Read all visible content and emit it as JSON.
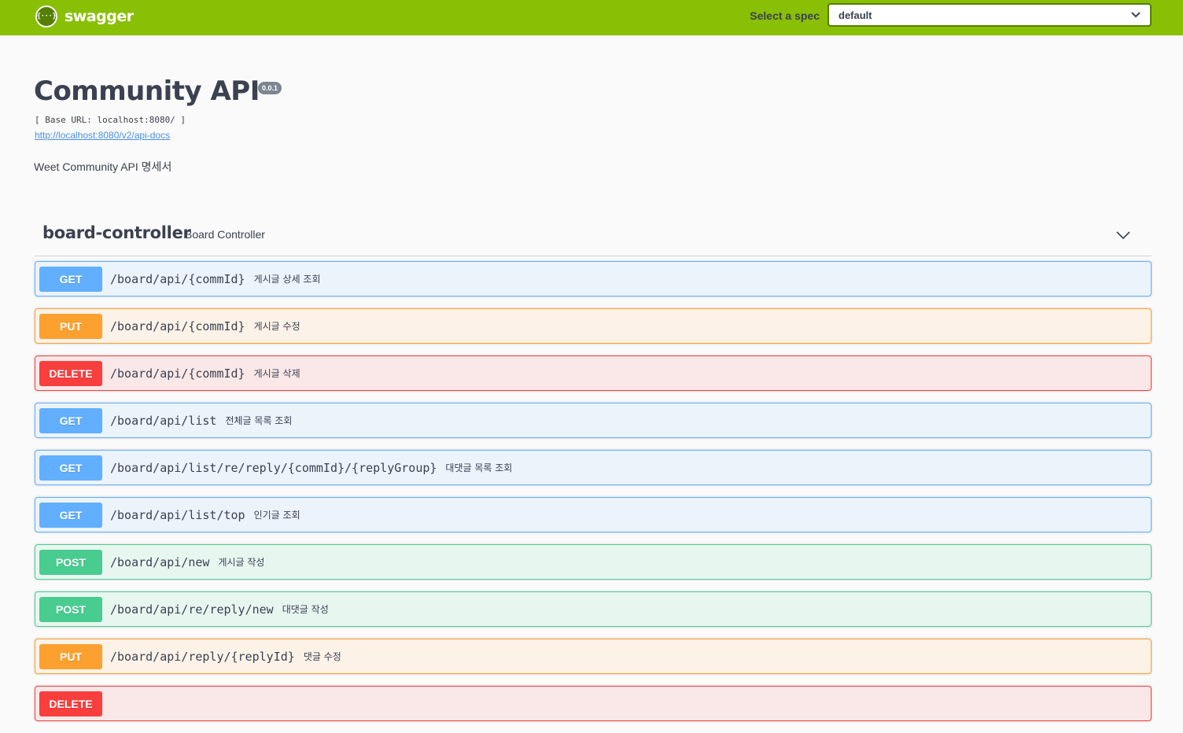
{
  "topbar": {
    "logo_text": "swagger",
    "logo_icon_glyph": "{···}",
    "select_label": "Select a spec",
    "select_value": "default"
  },
  "info": {
    "title": "Community API",
    "version": "0.0.1",
    "base_url": "[ Base URL: localhost:8080/ ]",
    "docs_link": "http://localhost:8080/v2/api-docs",
    "description": "Weet Community API 명세서"
  },
  "tag": {
    "name": "board-controller",
    "description": "Board Controller"
  },
  "operations": [
    {
      "method": "GET",
      "type": "get",
      "path": "/board/api/{commId}",
      "summary": "게시글 상세 조회"
    },
    {
      "method": "PUT",
      "type": "put",
      "path": "/board/api/{commId}",
      "summary": "게시글 수정"
    },
    {
      "method": "DELETE",
      "type": "delete",
      "path": "/board/api/{commId}",
      "summary": "게시글 삭제"
    },
    {
      "method": "GET",
      "type": "get",
      "path": "/board/api/list",
      "summary": "전체글 목록 조회"
    },
    {
      "method": "GET",
      "type": "get",
      "path": "/board/api/list/re/reply/{commId}/{replyGroup}",
      "summary": "대댓글 목록 조회"
    },
    {
      "method": "GET",
      "type": "get",
      "path": "/board/api/list/top",
      "summary": "인기글 조회"
    },
    {
      "method": "POST",
      "type": "post",
      "path": "/board/api/new",
      "summary": "게시글 작성"
    },
    {
      "method": "POST",
      "type": "post",
      "path": "/board/api/re/reply/new",
      "summary": "대댓글 작성"
    },
    {
      "method": "PUT",
      "type": "put",
      "path": "/board/api/reply/{replyId}",
      "summary": "댓글 수정"
    },
    {
      "method": "DELETE",
      "type": "delete",
      "path": "",
      "summary": ""
    }
  ],
  "colors": {
    "topbar": "#89bf04",
    "get": "#61affe",
    "put": "#fca130",
    "delete": "#f93e3e",
    "post": "#49cc90"
  }
}
